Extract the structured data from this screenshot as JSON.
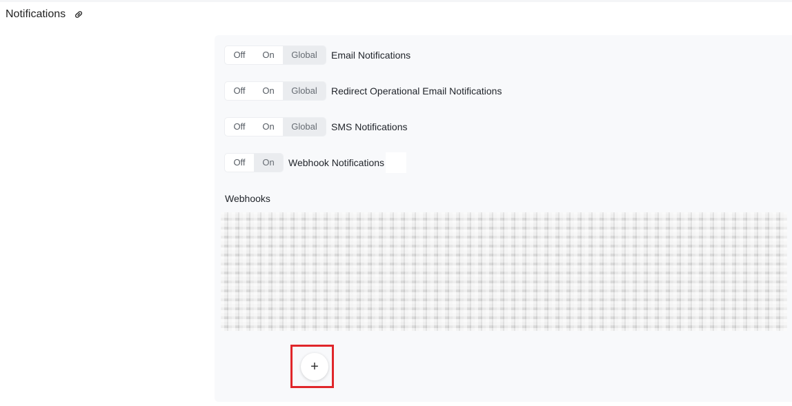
{
  "header": {
    "title": "Notifications",
    "link_icon": "link-icon"
  },
  "segment_options": {
    "off": "Off",
    "on": "On",
    "global": "Global"
  },
  "settings": [
    {
      "label": "Email Notifications",
      "selected": "Global"
    },
    {
      "label": "Redirect Operational Email Notifications",
      "selected": "Global"
    },
    {
      "label": "SMS Notifications",
      "selected": "Global"
    },
    {
      "label": "Webhook Notifications",
      "selected": "On"
    }
  ],
  "webhooks": {
    "title": "Webhooks",
    "add_label": "+"
  },
  "colors": {
    "panel_bg": "#f8f9fb",
    "active_segment_bg": "#eaecef",
    "highlight": "#e0262a"
  }
}
